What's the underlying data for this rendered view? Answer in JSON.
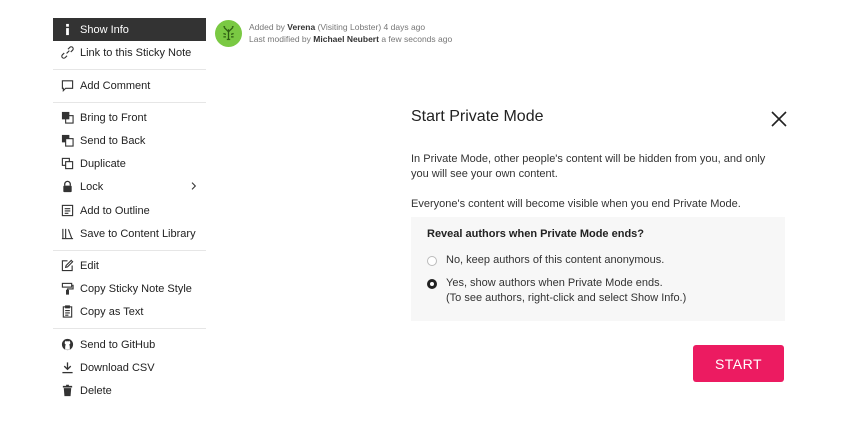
{
  "context_menu": {
    "items": [
      {
        "label": "Show Info",
        "icon": "info-icon"
      },
      {
        "label": "Link to this Sticky Note",
        "icon": "link-icon"
      },
      {
        "label": "Add Comment",
        "icon": "comment-icon"
      },
      {
        "label": "Bring to Front",
        "icon": "bring-to-front-icon"
      },
      {
        "label": "Send to Back",
        "icon": "send-to-back-icon"
      },
      {
        "label": "Duplicate",
        "icon": "duplicate-icon"
      },
      {
        "label": "Lock",
        "icon": "lock-icon"
      },
      {
        "label": "Add to Outline",
        "icon": "outline-icon"
      },
      {
        "label": "Save to Content Library",
        "icon": "library-icon"
      },
      {
        "label": "Edit",
        "icon": "edit-icon"
      },
      {
        "label": "Copy Sticky Note Style",
        "icon": "paint-roller-icon"
      },
      {
        "label": "Copy as Text",
        "icon": "clipboard-icon"
      },
      {
        "label": "Send to GitHub",
        "icon": "github-icon"
      },
      {
        "label": "Download CSV",
        "icon": "download-icon"
      },
      {
        "label": "Delete",
        "icon": "trash-icon"
      }
    ]
  },
  "author_info": {
    "added_prefix": "Added by",
    "added_by": "Verena",
    "added_suffix": "(Visiting Lobster) 4 days ago",
    "modified_prefix": "Last modified by",
    "modified_by": "Michael Neubert",
    "modified_suffix": "a few seconds ago"
  },
  "dialog": {
    "title": "Start Private Mode",
    "description": "In Private Mode, other people's content will be hidden from you, and only you will see your own content.",
    "visibility_note": "Everyone's content will become visible when you end Private Mode.",
    "option_title": "Reveal authors when Private Mode ends?",
    "option_no": "No, keep authors of this content anonymous.",
    "option_yes_line1": "Yes, show authors when Private Mode ends.",
    "option_yes_line2": "(To see authors, right-click and select Show Info.)",
    "selected_option": "yes",
    "start_label": "START"
  },
  "colors": {
    "accent": "#ec1b61",
    "menu_active_bg": "#333333",
    "avatar_bg": "#7ac943"
  }
}
